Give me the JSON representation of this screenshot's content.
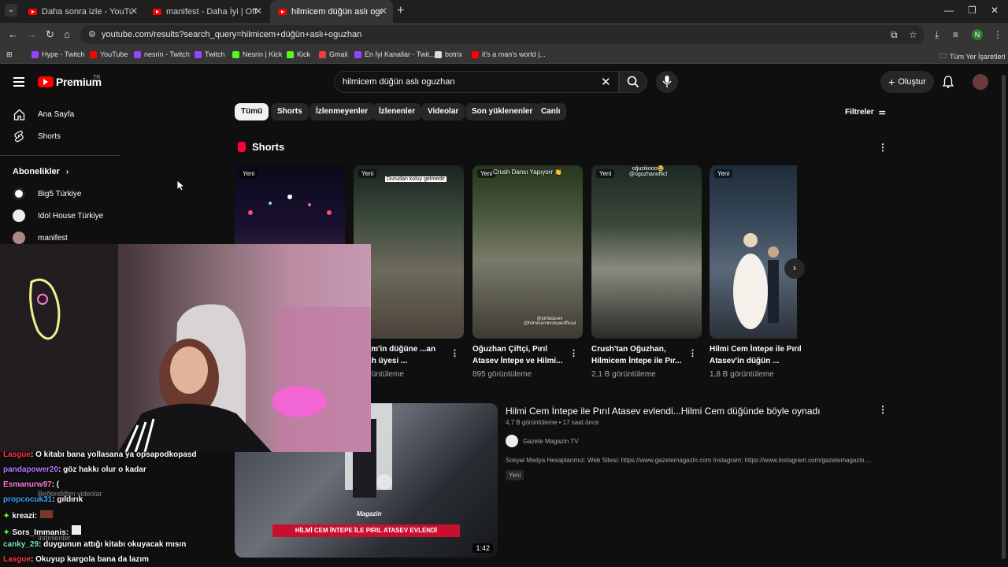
{
  "browser": {
    "tabs": [
      {
        "title": "Daha sonra izle - YouTube",
        "active": false
      },
      {
        "title": "manifest - Daha İyi | Official Mu",
        "active": false
      },
      {
        "title": "hilmicem düğün aslı oguzhan -",
        "active": true
      }
    ],
    "url": "youtube.com/results?search_query=hilmicem+düğün+aslı+oguzhan",
    "bookmarks": [
      {
        "label": "Hype - Twitch",
        "color": "#9146ff"
      },
      {
        "label": "YouTube",
        "color": "#ff0000"
      },
      {
        "label": "nesrin - Twitch",
        "color": "#9146ff"
      },
      {
        "label": "Twitch",
        "color": "#9146ff"
      },
      {
        "label": "Nesrin | Kick",
        "color": "#53fc18"
      },
      {
        "label": "Kick",
        "color": "#53fc18"
      },
      {
        "label": "Gmail",
        "color": "#ea4335"
      },
      {
        "label": "En İyi Kanallar - Twit...",
        "color": "#9146ff"
      },
      {
        "label": "botrix",
        "color": "#dddddd"
      },
      {
        "label": "it's a man's world |...",
        "color": "#ff0000"
      }
    ],
    "all_bookmarks": "Tüm Yer İşaretleri",
    "profile_initial": "N"
  },
  "header": {
    "logo_text": "Premium",
    "logo_region": "TR",
    "search_query": "hilmicem düğün aslı oguzhan",
    "create_label": "Oluştur"
  },
  "sidebar": {
    "home": "Ana Sayfa",
    "shorts": "Shorts",
    "subscriptions_heading": "Abonelikler",
    "channels": [
      "Big5 Türkiye",
      "Idol House Türkiye",
      "manifest"
    ],
    "faded_items": [
      "Beğendiğim videolar",
      "İndirilenler"
    ]
  },
  "chips": [
    "Tümü",
    "Shorts",
    "İzlenmeyenler",
    "İzlenenler",
    "Videolar",
    "Son yüklenenler",
    "Canlı"
  ],
  "filters_label": "Filtreler",
  "shorts_section": {
    "title": "Shorts",
    "items": [
      {
        "badge": "Yeni",
        "title": "",
        "views": ""
      },
      {
        "badge": "Yeni",
        "title": "...icem'in düğüne ...an Crush üyesi ...",
        "views": "...görüntüleme",
        "overlay": "Durudan koluy gelmedir"
      },
      {
        "badge": "Yeni",
        "title": "Oğuzhan Çiftçi, Pırıl Atasev İntepe ve Hilmi...",
        "views": "895 görüntüleme",
        "overlay": "Crush Dansı Yapıyorr 👏",
        "overlay2": "@pirilatasev @hilmiceminntepeofficial"
      },
      {
        "badge": "Yeni",
        "title": "Crush'tan Oğuzhan, Hilmicem İntepe ile Pır...",
        "views": "2,1 B görüntüleme",
        "overlay": "oğuzikooo😂 @oguzhanofficl"
      },
      {
        "badge": "Yeni",
        "title": "Hilmi Cem İntepe ile Pırıl Atasev'in düğün ...",
        "views": "1,8 B görüntüleme"
      }
    ]
  },
  "video_result": {
    "title": "Hilmi Cem İntepe ile Pırıl Atasev evlendi...Hilmi Cem düğünde böyle oynadı",
    "meta": "4,7 B görüntüleme • 17 saat önce",
    "channel": "Gazete Magazin TV",
    "description": "Sosyal Medya Hesaplarımız: Web Sitesi: https://www.gazetemagazin.com Instagram: https://www.instagram.com/gazetemagazin ...",
    "badge": "Yeni",
    "duration": "1:42",
    "thumb_banner": "HİLMİ CEM İNTEPE İLE PIRIL ATASEV EVLENDİ",
    "thumb_brand": "Magazin"
  },
  "chat": [
    {
      "user": "Lasgue",
      "message": ": O kitabı bana yollasana ya opsapodkopasd",
      "color": "#ff3b3b"
    },
    {
      "user": "pandapower20",
      "message": ": göz hakkı olur o kadar",
      "color": "#b57dff"
    },
    {
      "user": "Esmanurw97",
      "message": ": (",
      "color": "#ff7ae0"
    },
    {
      "user": "propcocuk31",
      "message": ": gıldırık",
      "color": "#3da5ff"
    },
    {
      "user": "kreazi",
      "message": ":",
      "color": "#ffffff"
    },
    {
      "user": "Sors_Immanis",
      "message": ":",
      "color": "#ffffff"
    },
    {
      "user": "canky_29",
      "message": ": duygunun attığı kitabı okuyacak mısın",
      "color": "#7fe0c0"
    },
    {
      "user": "Lasgue",
      "message": ": Okuyup kargola bana da lazım",
      "color": "#ff3b3b"
    }
  ]
}
